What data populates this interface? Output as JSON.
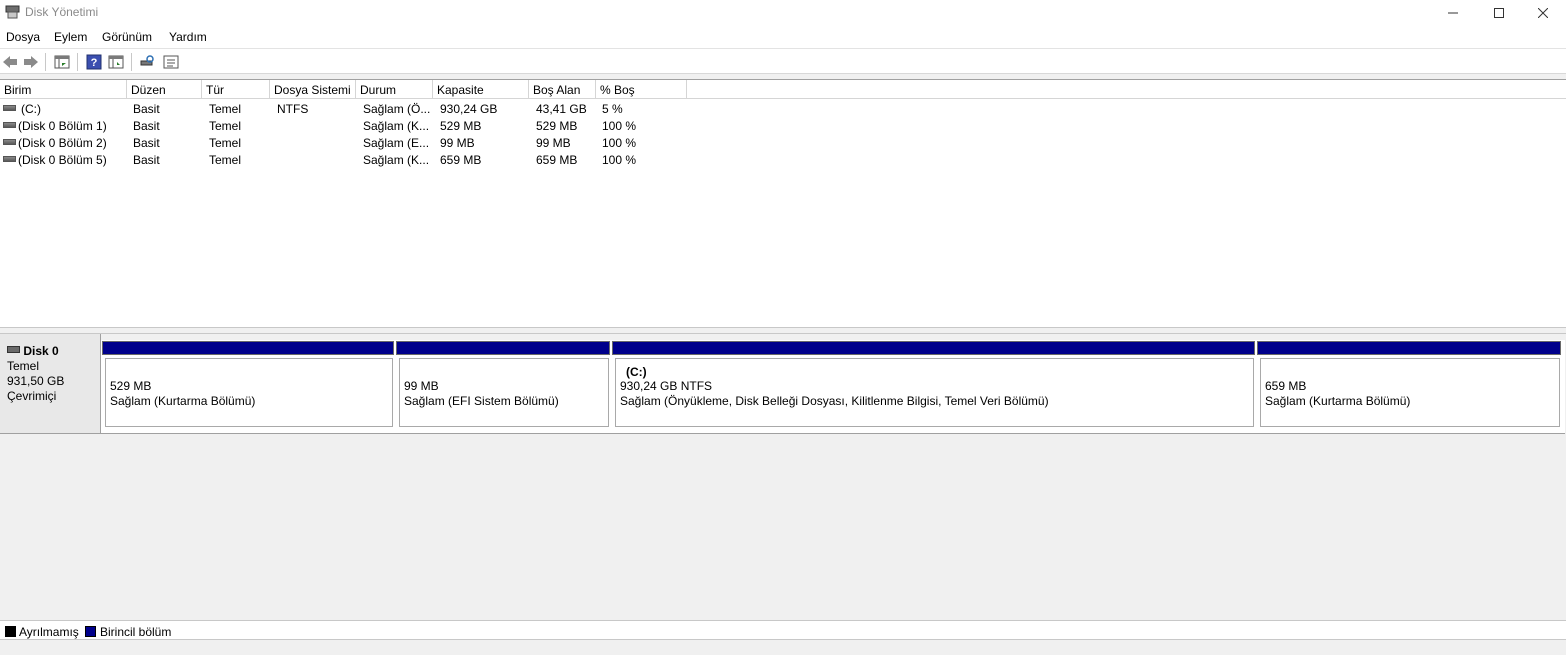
{
  "window": {
    "title": "Disk Yönetimi"
  },
  "menu": [
    "Dosya",
    "Eylem",
    "Görünüm",
    "Yardım"
  ],
  "toolbar": [
    "back-icon",
    "forward-icon",
    "up-pane-icon",
    "help-icon",
    "show-hide-pane-icon",
    "rescan-disks-icon",
    "properties-list-icon"
  ],
  "list": {
    "columns": [
      "Birim",
      "Düzen",
      "Tür",
      "Dosya Sistemi",
      "Durum",
      "Kapasite",
      "Boş Alan",
      "% Boş"
    ],
    "rows": [
      [
        "(C:)",
        "Basit",
        "Temel",
        "NTFS",
        "Sağlam (Ö...",
        "930,24 GB",
        "43,41 GB",
        "5 %"
      ],
      [
        "(Disk 0 Bölüm 1)",
        "Basit",
        "Temel",
        "",
        "Sağlam (K...",
        "529 MB",
        "529 MB",
        "100 %"
      ],
      [
        "(Disk 0 Bölüm 2)",
        "Basit",
        "Temel",
        "",
        "Sağlam (E...",
        "99 MB",
        "99 MB",
        "100 %"
      ],
      [
        "(Disk 0 Bölüm 5)",
        "Basit",
        "Temel",
        "",
        "Sağlam (K...",
        "659 MB",
        "659 MB",
        "100 %"
      ]
    ]
  },
  "disk": {
    "name": "Disk 0",
    "type": "Temel",
    "size": "931,50 GB",
    "status": "Çevrimiçi",
    "partitions": [
      {
        "title": "",
        "size": "529 MB",
        "status": "Sağlam (Kurtarma Bölümü)"
      },
      {
        "title": "",
        "size": "99 MB",
        "status": "Sağlam (EFI Sistem Bölümü)"
      },
      {
        "title": "(C:)",
        "size": "930,24 GB NTFS",
        "status": "Sağlam (Önyükleme, Disk Belleği Dosyası, Kilitlenme Bilgisi, Temel Veri Bölümü)"
      },
      {
        "title": "",
        "size": "659 MB",
        "status": "Sağlam (Kurtarma Bölümü)"
      }
    ]
  },
  "legend": [
    {
      "label": "Ayrılmamış",
      "color": "#000000"
    },
    {
      "label": "Birincil bölüm",
      "color": "#00008b"
    }
  ]
}
